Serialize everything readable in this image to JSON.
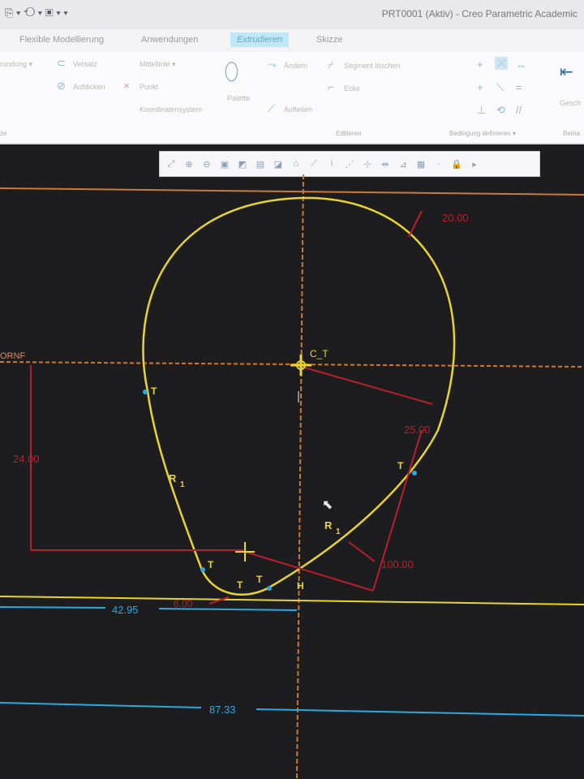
{
  "titlebar": {
    "quick_access": "⎘ ▾ ⟲ ▾ ▣ ▾ ▾",
    "title": "PRT0001 (Aktiv) - Creo Parametric Academic"
  },
  "tabs": [
    {
      "label": "Flexible Modellierung"
    },
    {
      "label": "Anwendungen"
    },
    {
      "label": "Extrudieren"
    },
    {
      "label": "Skizze"
    }
  ],
  "ribbon": {
    "rundung": "rundung ▾",
    "versatz": "Versatz",
    "mittellinie": "Mittellinie ▾",
    "aufdicken": "Aufdicken",
    "punkt": "Punkt",
    "koordinatensystem": "Koordinatensystem",
    "palette": "Palette",
    "aendern": "Ändern",
    "segment_loeschen": "Segment löschen",
    "ecke": "Ecke",
    "aufteilen": "Aufteilen",
    "group_editieren": "Editieren",
    "group_bedingung": "Bedingung definieren ▾",
    "group_bema": "Bema",
    "gesch": "Gesch",
    "group_ze": "ze"
  },
  "sketch": {
    "label_ornf": "ORNF",
    "label_ct": "C_T",
    "dim_radius_top": "20.00",
    "dim_arc_right": "25.00",
    "dim_height": "24.00",
    "dim_radius_large": "100.00",
    "dim_bottom_radius": "6.00",
    "dim_horizontal_1": "42.95",
    "dim_horizontal_2": "87.33",
    "label_r1_left": "R",
    "label_r1_left_sub": "1",
    "label_r1_right": "R",
    "label_r1_right_sub": "1",
    "label_h": "H",
    "label_t": "T"
  },
  "colors": {
    "sketch_yellow": "#e7d433",
    "dimension_red": "#b81f2c",
    "dimension_blue": "#2aa8e0",
    "reference_orange": "#c77a3a",
    "canvas_bg": "#1d1d20"
  }
}
